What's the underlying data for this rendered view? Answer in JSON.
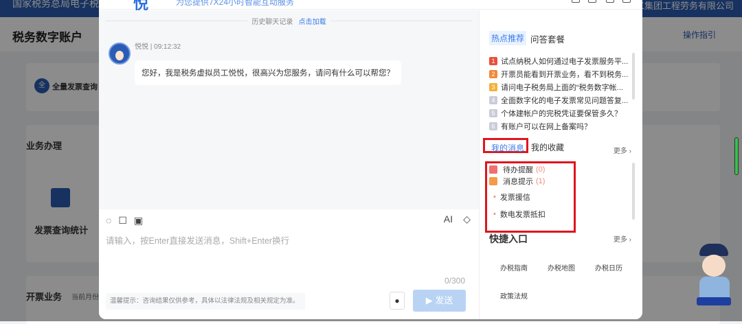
{
  "background": {
    "top_left": "国家税务总局电子税务局",
    "top_right": "工集团工程劳务有限公司",
    "page_title": "税务数字账户",
    "guide": "操作指引",
    "quick_item": "全量发票查询",
    "quick_badge": "全",
    "section1": "业务办理",
    "card1": "发票查询统计",
    "section2": "开票业务",
    "section2_sub": "当前月份"
  },
  "chat": {
    "logo": "悦",
    "slogan": "为您提供7X24小时智能互动服务",
    "history_label": "历史聊天记录",
    "history_load": "点击加载",
    "sender": "悦悦 | 09:12:32",
    "message": "您好，我是税务虚拟员工悦悦，很高兴为您服务，请问有什么可以帮您？",
    "ai_label": "AI",
    "placeholder": "请输入，按Enter直接发送消息，Shift+Enter换行",
    "count": "0/300",
    "tip": "温馨提示：咨询结果仅供参考，具体以法律法规及相关规定为准。",
    "send": "发送"
  },
  "side": {
    "tabs": [
      "热点推荐",
      "问答套餐"
    ],
    "hot": [
      {
        "n": "1",
        "t": "试点纳税人如何通过电子发票服务平...",
        "c": "#e8503a"
      },
      {
        "n": "2",
        "t": "开票员能看到开票业务，看不到税务...",
        "c": "#f08a3a"
      },
      {
        "n": "3",
        "t": "请问电子税务局上面的“税务数字帐...",
        "c": "#f5b03a"
      },
      {
        "n": "4",
        "t": "全面数字化的电子发票常见问题答复...",
        "c": "#c8cdd8"
      },
      {
        "n": "5",
        "t": "个体建帐户的完税凭证要保管多久？",
        "c": "#c8cdd8"
      },
      {
        "n": "6",
        "t": "有账户可以在网上备案吗？",
        "c": "#c8cdd8"
      }
    ],
    "msg_tabs": [
      "我的消息",
      "我的收藏"
    ],
    "more": "更多 ›",
    "todo": "待办提醒",
    "todo_count": "(0)",
    "notice": "消息提示",
    "notice_count": "(1)",
    "notices": [
      "发票援信",
      "数电发票抵扣"
    ],
    "quick_title": "快捷入口",
    "quick": [
      "办税指南",
      "办税地图",
      "办税日历",
      "政策法规"
    ]
  }
}
